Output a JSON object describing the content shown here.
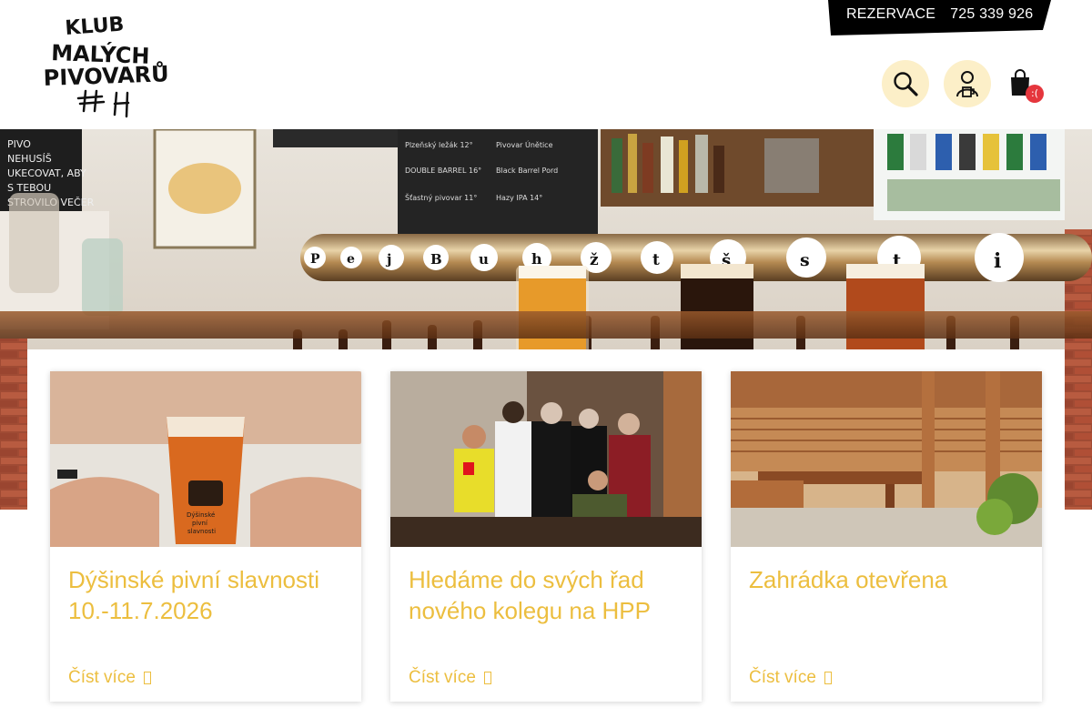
{
  "brand": {
    "logo_lines": [
      "KLUB",
      "MALÝCH",
      "PIVOVARŮ"
    ],
    "logo_mark": "⌗ H"
  },
  "topbar": {
    "reservation_label": "REZERVACE",
    "phone": "725 339 926"
  },
  "header_icons": {
    "search": "search-icon",
    "account": "beer-user-icon",
    "cart": "shopping-bag-icon",
    "cart_badge": ":("
  },
  "hero": {
    "alt_scene": "bar-counter-with-beer-taps"
  },
  "articles": [
    {
      "title": "Dýšinské pivní slavnosti 10.-11.7.2026",
      "read_more": "Číst více"
    },
    {
      "title": "Hledáme do svých řad nového kolegu na HPP",
      "read_more": "Číst více"
    },
    {
      "title": "Zahrádka otevřena",
      "read_more": "Číst více"
    }
  ],
  "colors": {
    "accent": "#ecbe3f",
    "icon_circle": "#fcefc8",
    "badge": "#e5363d",
    "topbar": "#000000"
  }
}
